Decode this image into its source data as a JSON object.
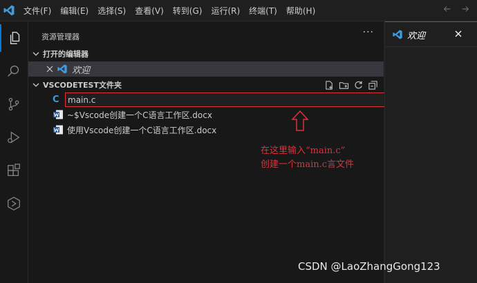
{
  "menu": [
    "文件(F)",
    "编辑(E)",
    "选择(S)",
    "查看(V)",
    "转到(G)",
    "运行(R)",
    "终端(T)",
    "帮助(H)"
  ],
  "sidebar": {
    "title": "资源管理器",
    "more": "···",
    "open_editors": {
      "header": "打开的编辑器",
      "items": [
        {
          "label": "欢迎",
          "icon": "vscode-icon"
        }
      ]
    },
    "folder": {
      "header": "VSCODETEST文件夹",
      "editing_value": "main.c",
      "editing_icon_text": "C",
      "files": [
        {
          "label": "~$Vscode创建一个C语言工作区.docx",
          "icon": "word-icon"
        },
        {
          "label": "使用Vscode创建一个C语言工作区.docx",
          "icon": "word-icon"
        }
      ]
    }
  },
  "annotation": {
    "line1": "在这里输入“main.c”",
    "line2": "创建一个main.c言文件",
    "color": "#e0303a"
  },
  "editor": {
    "tab_label": "欢迎"
  },
  "watermark": "CSDN @LaoZhangGong123",
  "colors": {
    "accent": "#0078d4",
    "vscode_blue": "#3f9be0",
    "word_blue": "#2b579a"
  }
}
